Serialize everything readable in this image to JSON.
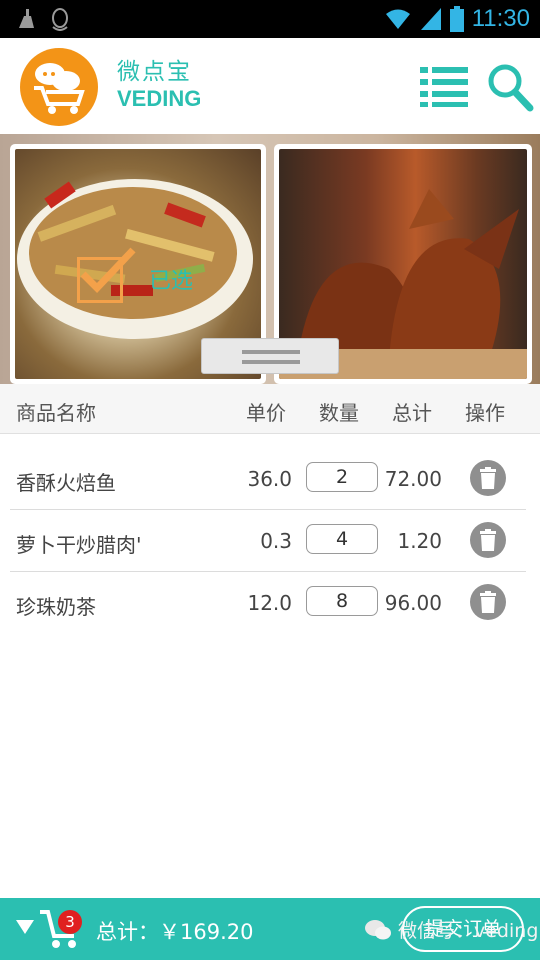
{
  "status_bar": {
    "time": "11:30"
  },
  "header": {
    "brand_cn": "微点宝",
    "brand_en": "VEDING"
  },
  "carousel": {
    "selected_label": "已选"
  },
  "table": {
    "headers": {
      "name": "商品名称",
      "price": "单价",
      "qty": "数量",
      "total": "总计",
      "action": "操作"
    },
    "rows": [
      {
        "name": "香酥火焙鱼",
        "price": "36.0",
        "qty": "2",
        "total": "72.00"
      },
      {
        "name": "萝卜干炒腊肉'",
        "price": "0.3",
        "qty": "4",
        "total": "1.20"
      },
      {
        "name": "珍珠奶茶",
        "price": "12.0",
        "qty": "8",
        "total": "96.00"
      }
    ]
  },
  "footer": {
    "cart_count": "3",
    "total_label": "总计：￥169.20",
    "submit_label": "提交订单",
    "watermark": "微信号：veding"
  },
  "colors": {
    "accent": "#2bbfb1",
    "logo": "#f39417",
    "badge": "#e02020"
  }
}
